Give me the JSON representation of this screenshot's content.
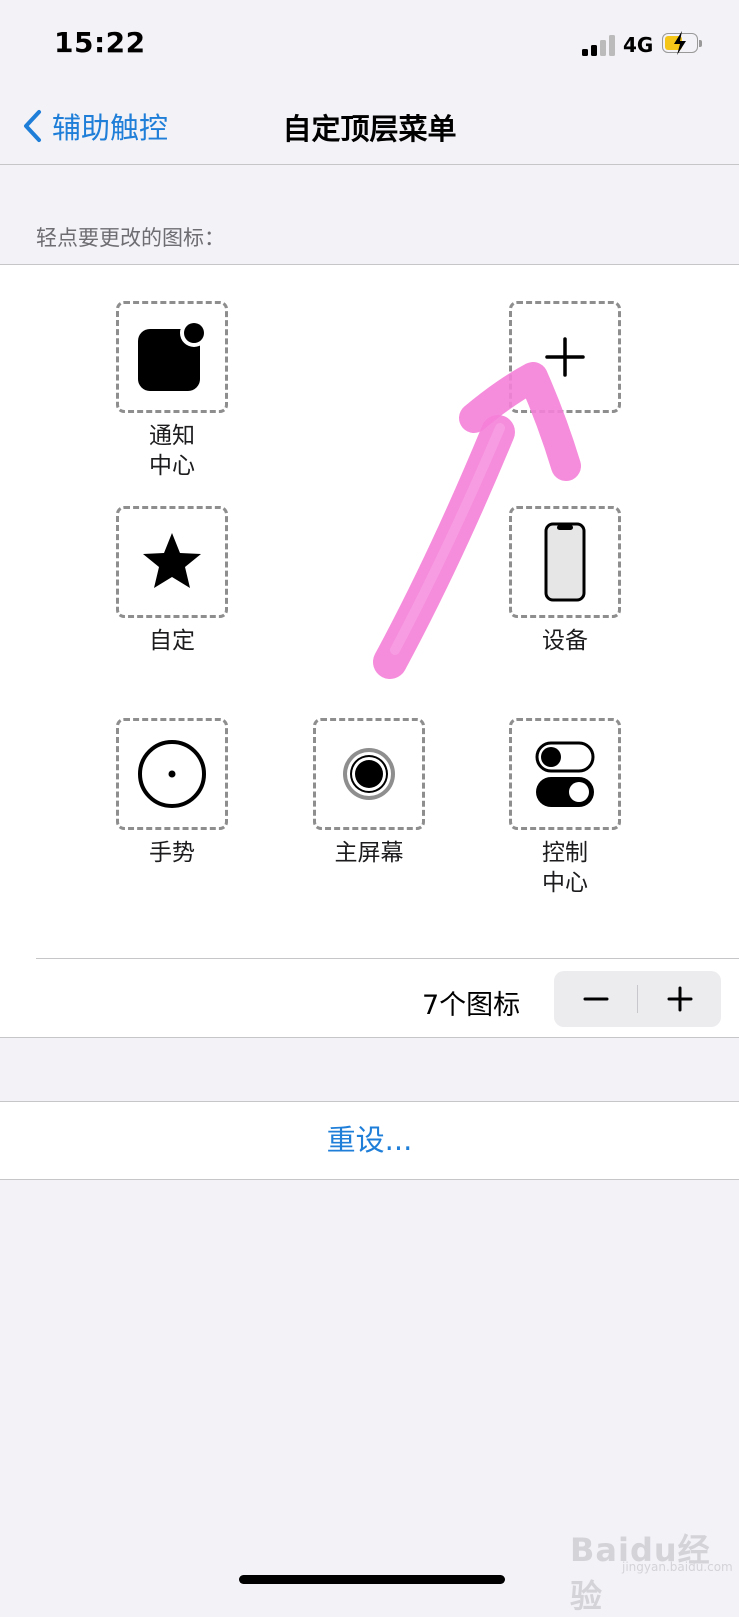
{
  "status_bar": {
    "time": "15:22",
    "network": "4G"
  },
  "nav": {
    "back_label": "辅助触控",
    "title": "自定顶层菜单"
  },
  "section_header": "轻点要更改的图标：",
  "slots": [
    {
      "label": "通知\n中心",
      "icon": "notification-center-icon"
    },
    {
      "label": "",
      "icon": "plus-icon"
    },
    {
      "label": "自定",
      "icon": "star-icon"
    },
    {
      "label": "设备",
      "icon": "device-iphone-icon"
    },
    {
      "label": "手势",
      "icon": "gesture-circle-icon"
    },
    {
      "label": "主屏幕",
      "icon": "home-button-icon"
    },
    {
      "label": "控制\n中心",
      "icon": "control-center-toggles-icon"
    }
  ],
  "icon_count": {
    "label": "7个图标"
  },
  "stepper": {
    "minus": "−",
    "plus": "+"
  },
  "reset": {
    "label": "重设..."
  },
  "watermark": {
    "text": "Baidu经验",
    "url": "jingyan.baidu.com"
  },
  "colors": {
    "accent": "#1e7ed8",
    "annotation": "#f57fd8",
    "battery": "#f5c518"
  }
}
